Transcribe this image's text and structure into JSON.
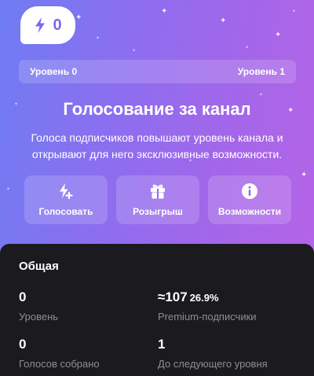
{
  "boost": {
    "count": "0",
    "icon": "lightning-icon"
  },
  "levels": {
    "current": "Уровень 0",
    "next": "Уровень 1",
    "progress": 0
  },
  "header": {
    "title": "Голосование за канал",
    "description": "Голоса подписчиков повышают уровень канала и открывают для него эксклюзивные возможности."
  },
  "actions": [
    {
      "label": "Голосовать",
      "icon": "boost-plus-icon"
    },
    {
      "label": "Розыгрыш",
      "icon": "gift-icon"
    },
    {
      "label": "Возможности",
      "icon": "info-icon"
    }
  ],
  "overview": {
    "title": "Общая",
    "level": {
      "value": "0",
      "label": "Уровень"
    },
    "premium": {
      "value": "≈107",
      "percent": "26.9%",
      "label": "Premium-подписчики"
    },
    "votes": {
      "value": "0",
      "label": "Голосов собрано"
    },
    "next_level": {
      "value": "1",
      "label": "До следующего уровня"
    }
  },
  "colors": {
    "gradient_start": "#6f7cf2",
    "gradient_end": "#b564e6",
    "badge_text": "#7a68ee",
    "panel_bg": "#1b1b1f",
    "muted_text": "#8d8d93"
  }
}
